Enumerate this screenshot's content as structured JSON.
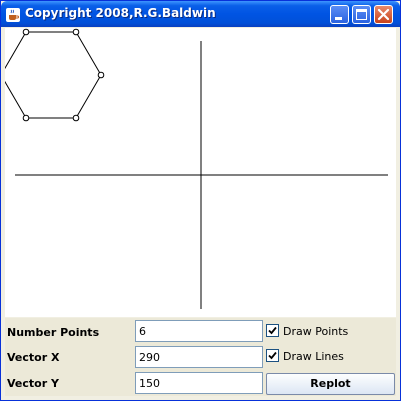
{
  "window": {
    "title": "Copyright 2008,R.G.Baldwin"
  },
  "controls": {
    "number_points_label": "Number Points",
    "number_points_value": "6",
    "vector_x_label": "Vector X",
    "vector_x_value": "290",
    "vector_y_label": "Vector Y",
    "vector_y_value": "150",
    "draw_points_label": "Draw Points",
    "draw_points_checked": true,
    "draw_lines_label": "Draw Lines",
    "draw_lines_checked": true,
    "replot_label": "Replot"
  },
  "icons": [
    "java-cup-icon",
    "minimize-icon",
    "maximize-icon",
    "close-icon",
    "checkmark-icon"
  ],
  "colors": {
    "titlebar": "#0054e3",
    "close_button": "#c8421a",
    "canvas": "#ffffff",
    "panel": "#ece9d8"
  }
}
